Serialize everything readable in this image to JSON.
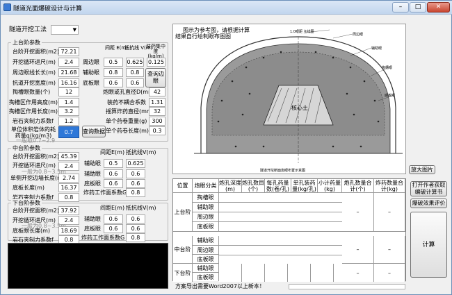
{
  "window": {
    "title": "隧道光面爆破设计与计算",
    "min": "–",
    "max": "□",
    "close": "✕"
  },
  "method": {
    "label": "隧道开挖工法",
    "value": ""
  },
  "upper": {
    "title": "上台阶参数",
    "area_label": "台阶开挖面积(m2)",
    "area": "72.21",
    "advance_label": "开挖循环进尺(m)",
    "advance": "2.4",
    "perimeter_label": "周边眼线长长(m)",
    "perimeter": "21.68",
    "width_label": "抗道开挖宽度(m)",
    "width": "16.16",
    "cut_count_label": "掏槽眼数量(个)",
    "cut_count": "12",
    "cut_height_label": "掏槽区作用高度(m)",
    "cut_height": "1.4",
    "cut_length_label": "掏槽区作用长度(m)",
    "cut_length": "3.2",
    "rock_label": "岩石夹制力系数f",
    "rock": "1.2",
    "unit_label": "单位体积岩体的耗药量q(kg/m3)",
    "unit": "0.7",
    "unit_hint": "一般取0.7~2.9",
    "col_spacing": "间距 E(m)",
    "col_burden": "抵抗线 V(m)",
    "col_density": "装药集中度 (kg/m)",
    "rows": [
      {
        "label": "周边眼",
        "spacing": "0.5",
        "burden": "0.625",
        "density": "0.125"
      },
      {
        "label": "辅助眼",
        "spacing": "0.8",
        "burden": "0.8"
      },
      {
        "label": "底板眼",
        "spacing": "0.6",
        "burden": "0.6"
      }
    ],
    "lookup_btn": "查询边眼",
    "hole_diam_label": "炮眼或孔直径D(mm)",
    "hole_diam": "42",
    "decouple_label": "装药不耦合系数",
    "decouple": "1.31",
    "cart_diam_label": "摇算炸药直径(mm)",
    "cart_diam": "32",
    "cart_weight_label": "单个药卷重量(g)",
    "cart_weight": "300",
    "cart_length_label": "单个药卷长度(m)",
    "cart_length": "0.3",
    "query_btn": "查询数据"
  },
  "middle": {
    "title": "中台阶参数",
    "area_label": "台阶开挖面积(m2)",
    "area": "45.39",
    "advance_label": "开挖循环进尺(m)",
    "advance": "2.4",
    "advance_hint": "一般为0.8~3.5m",
    "wall_label": "单侧开挖边墙长度(m)",
    "wall": "2.74",
    "floor_label": "底板长度(m)",
    "floor": "16.37",
    "rock_label": "岩石夹制力系数f",
    "rock": "0.8",
    "col_spacing": "间距E(m)",
    "col_burden": "抵抗线V(m)",
    "rows": [
      {
        "label": "辅助眼",
        "spacing": "0.5",
        "burden": "0.625"
      },
      {
        "label": "辅助眼",
        "spacing": "0.6",
        "burden": "0.6"
      },
      {
        "label": "底板眼",
        "spacing": "0.6",
        "burden": "0.6"
      }
    ],
    "charge_label": "炸药工作面系数G",
    "charge": "0.8"
  },
  "lower": {
    "title": "下台阶参数",
    "area_label": "台阶开挖面积(m2)",
    "area": "37.92",
    "advance_label": "开挖循环进尺(m)",
    "advance": "2.4",
    "advance_hint": "一般为0.8~3.5m",
    "floor_label": "底板眼长度(m)",
    "floor": "18.69",
    "rock_label": "岩石夹制力系数f",
    "rock": "0.8",
    "col_spacing": "间距E(m)",
    "col_burden": "抵抗线V(m)",
    "rows": [
      {
        "label": "辅助眼",
        "spacing": "0.6",
        "burden": "0.6"
      },
      {
        "label": "底板眼",
        "spacing": "0.6",
        "burden": "0.6"
      }
    ],
    "charge_label": "炸药工作面系数G",
    "charge": "0.8"
  },
  "diagram": {
    "note1": "图示为参考图，请根据计算",
    "note2": "结果自行绘制眼布图图",
    "center": "核心土",
    "labels": [
      "1.0眼距 主线图",
      "周边眼",
      "辅助眼",
      "掏槽眼",
      "底板眼"
    ],
    "bottom_label": "隧道开挖断面炮眼布置示意图",
    "zoom_btn": "放大图片"
  },
  "results": {
    "headers": [
      "位置",
      "炮眼分类",
      "炮孔深度(m)",
      "炮孔数目(个)",
      "每孔药量数(卷/孔)",
      "单孔装药量(kg/孔)",
      "小计药量(kg)",
      "炮孔数量合计(个)",
      "炸药数量合计(kg)"
    ],
    "upper": {
      "name": "上台阶",
      "rows": [
        "掏槽眼",
        "辅助眼",
        "周边眼",
        "底板眼"
      ],
      "sum_holes": "–",
      "sum_charge": "–"
    },
    "middle": {
      "name": "中台阶",
      "rows": [
        "辅助眼",
        "周边眼",
        "底板眼"
      ],
      "sum_holes": "–",
      "sum_charge": "–"
    },
    "lower": {
      "name": "下台阶",
      "rows": [
        "辅助眼",
        "底板眼"
      ],
      "sum_holes": "–",
      "sum_charge": "–"
    }
  },
  "side": {
    "print_btn": "打开作者获取编破计算书",
    "eval_btn": "爆破效果评价",
    "calc_btn": "计算"
  },
  "status": {
    "text": "方案导出需要Word2007以上新本！"
  }
}
